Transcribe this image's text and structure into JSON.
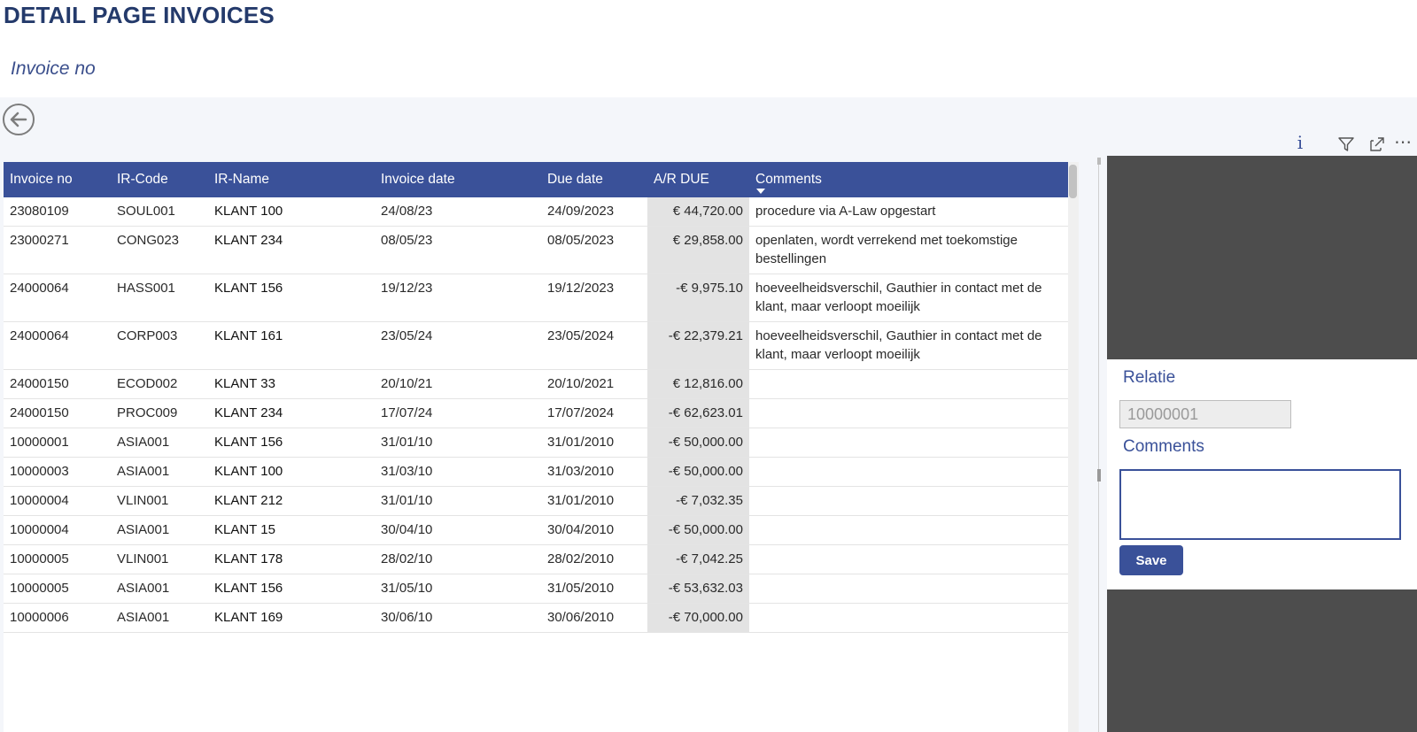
{
  "page": {
    "title": "DETAIL PAGE INVOICES",
    "subtitle": "Invoice no"
  },
  "visual_header": {
    "icons": [
      "info-icon",
      "filter-icon",
      "focus-mode-icon",
      "more-options-icon"
    ],
    "info_glyph": "i",
    "more_glyph": "⋯"
  },
  "table": {
    "columns": [
      "Invoice no",
      "IR-Code",
      "IR-Name",
      "Invoice date",
      "Due date",
      "A/R DUE",
      "Comments"
    ],
    "sorted_column": "Comments",
    "rows": [
      {
        "invoice_no": "23080109",
        "ir_code": "SOUL001",
        "ir_name": "KLANT 100",
        "invoice_date": "24/08/23",
        "due_date": "24/09/2023",
        "ar_due": "€ 44,720.00",
        "comments": "procedure via A-Law opgestart"
      },
      {
        "invoice_no": "23000271",
        "ir_code": "CONG023",
        "ir_name": "KLANT 234",
        "invoice_date": "08/05/23",
        "due_date": "08/05/2023",
        "ar_due": "€ 29,858.00",
        "comments": "openlaten, wordt verrekend met toekomstige bestellingen"
      },
      {
        "invoice_no": "24000064",
        "ir_code": "HASS001",
        "ir_name": "KLANT 156",
        "invoice_date": "19/12/23",
        "due_date": "19/12/2023",
        "ar_due": "-€ 9,975.10",
        "comments": "hoeveelheidsverschil, Gauthier in contact met de klant, maar verloopt moeilijk"
      },
      {
        "invoice_no": "24000064",
        "ir_code": "CORP003",
        "ir_name": "KLANT 161",
        "invoice_date": "23/05/24",
        "due_date": "23/05/2024",
        "ar_due": "-€ 22,379.21",
        "comments": "hoeveelheidsverschil, Gauthier in contact met de klant, maar verloopt moeilijk"
      },
      {
        "invoice_no": "24000150",
        "ir_code": "ECOD002",
        "ir_name": "KLANT 33",
        "invoice_date": "20/10/21",
        "due_date": "20/10/2021",
        "ar_due": "€ 12,816.00",
        "comments": ""
      },
      {
        "invoice_no": "24000150",
        "ir_code": "PROC009",
        "ir_name": "KLANT 234",
        "invoice_date": "17/07/24",
        "due_date": "17/07/2024",
        "ar_due": "-€ 62,623.01",
        "comments": ""
      },
      {
        "invoice_no": "10000001",
        "ir_code": "ASIA001",
        "ir_name": "KLANT 156",
        "invoice_date": "31/01/10",
        "due_date": "31/01/2010",
        "ar_due": "-€ 50,000.00",
        "comments": ""
      },
      {
        "invoice_no": "10000003",
        "ir_code": "ASIA001",
        "ir_name": "KLANT 100",
        "invoice_date": "31/03/10",
        "due_date": "31/03/2010",
        "ar_due": "-€ 50,000.00",
        "comments": ""
      },
      {
        "invoice_no": "10000004",
        "ir_code": "VLIN001",
        "ir_name": "KLANT 212",
        "invoice_date": "31/01/10",
        "due_date": "31/01/2010",
        "ar_due": "-€ 7,032.35",
        "comments": ""
      },
      {
        "invoice_no": "10000004",
        "ir_code": "ASIA001",
        "ir_name": "KLANT 15",
        "invoice_date": "30/04/10",
        "due_date": "30/04/2010",
        "ar_due": "-€ 50,000.00",
        "comments": ""
      },
      {
        "invoice_no": "10000005",
        "ir_code": "VLIN001",
        "ir_name": "KLANT 178",
        "invoice_date": "28/02/10",
        "due_date": "28/02/2010",
        "ar_due": "-€ 7,042.25",
        "comments": ""
      },
      {
        "invoice_no": "10000005",
        "ir_code": "ASIA001",
        "ir_name": "KLANT 156",
        "invoice_date": "31/05/10",
        "due_date": "31/05/2010",
        "ar_due": "-€ 53,632.03",
        "comments": ""
      },
      {
        "invoice_no": "10000006",
        "ir_code": "ASIA001",
        "ir_name": "KLANT 169",
        "invoice_date": "30/06/10",
        "due_date": "30/06/2010",
        "ar_due": "-€ 70,000.00",
        "comments": ""
      }
    ]
  },
  "form": {
    "relatie_label": "Relatie",
    "relatie_value": "10000001",
    "comments_label": "Comments",
    "comments_value": "",
    "save_label": "Save"
  },
  "colors": {
    "header_bg": "#3a5199",
    "title": "#243a6b",
    "ar_due_bg": "#e3e3e3",
    "panel_bg": "#4d4d4d"
  }
}
